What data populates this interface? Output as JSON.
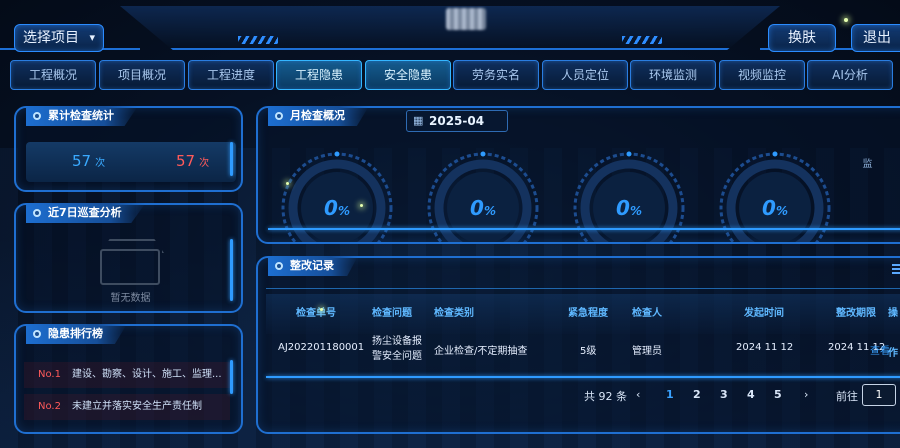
{
  "header": {
    "project_select_label": "选择项目",
    "skin_label": "换肤",
    "exit_label": "退出"
  },
  "nav": {
    "tabs": [
      {
        "label": "工程概况"
      },
      {
        "label": "项目概况"
      },
      {
        "label": "工程进度"
      },
      {
        "label": "工程隐患",
        "active": true
      },
      {
        "label": "安全隐患"
      },
      {
        "label": "劳务实名"
      },
      {
        "label": "人员定位"
      },
      {
        "label": "环境监测"
      },
      {
        "label": "视频监控"
      },
      {
        "label": "AI分析"
      }
    ]
  },
  "cumulative": {
    "title": "累计检查统计",
    "count_a": "57",
    "count_b": "57",
    "unit": "次",
    "colors": {
      "a": "#3aaaff",
      "b": "#ff5a5a"
    }
  },
  "seven_days": {
    "title": "近7日巡查分析",
    "empty_text": "暂无数据"
  },
  "ranking": {
    "title": "隐患排行榜",
    "items": [
      {
        "no": "No.1",
        "text": "建设、勘察、设计、施工、监理..."
      },
      {
        "no": "No.2",
        "text": "未建立并落实安全生产责任制"
      }
    ]
  },
  "monthly": {
    "title": "月检查概况",
    "month": "2025-04",
    "gauges": [
      {
        "value": "0",
        "unit": "%",
        "icon": "inspection-icon"
      },
      {
        "value": "0",
        "unit": "%",
        "icon": "document-icon"
      },
      {
        "value": "0",
        "unit": "%",
        "icon": "checklist-icon"
      },
      {
        "value": "0",
        "unit": "%",
        "icon": "phone-icon"
      }
    ],
    "side_text": "监",
    "accent": "#2f9bff"
  },
  "rectification": {
    "title": "整改记录",
    "columns": [
      "检查单号",
      "检查问题",
      "检查类别",
      "紧急程度",
      "检查人",
      "发起时间",
      "整改期限",
      "操作"
    ],
    "rows": [
      {
        "id": "AJ202201180001",
        "problem": "扬尘设备报警安全问题",
        "category": "企业检查/不定期抽查",
        "urgency": "5级",
        "inspector": "管理员",
        "start_time": "2024 11 12",
        "deadline": "2024 11 12",
        "action": "查看"
      }
    ],
    "pagination": {
      "total_text": "共 92 条",
      "prev": "‹",
      "pages": [
        "1",
        "2",
        "3",
        "4",
        "5"
      ],
      "current": "1",
      "next": "›",
      "goto_label": "前往",
      "goto_value": "1"
    }
  }
}
